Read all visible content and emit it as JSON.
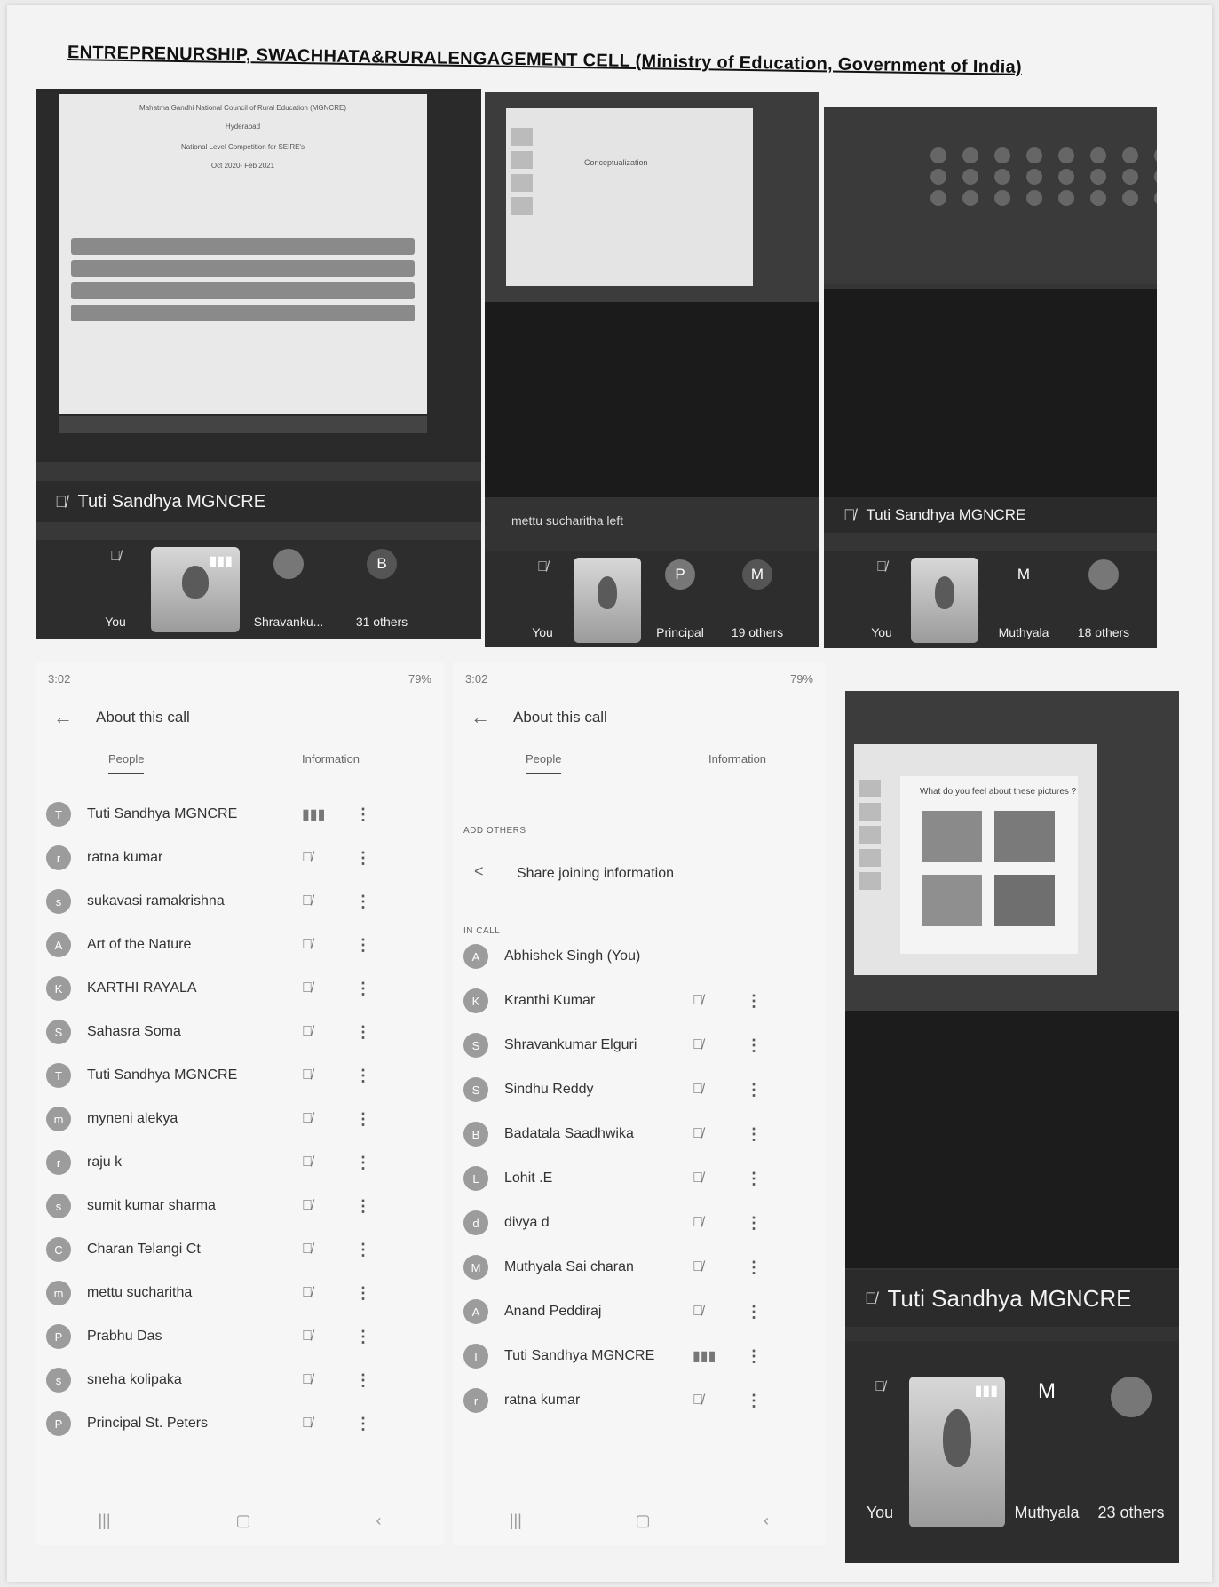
{
  "document": {
    "title": "ENTREPRENURSHIP, SWACHHATA&RURALENGAGEMENT CELL (Ministry of Education, Government of India)"
  },
  "shot1": {
    "doc_lines": [
      "Mahatma Gandhi National Council of Rural Education (MGNCRE)",
      "Hyderabad",
      "National Level Competition for SEIRE's",
      "Oct 2020- Feb 2021"
    ],
    "speaker": "Tuti Sandhya MGNCRE",
    "tiles": [
      {
        "label": "You"
      },
      {
        "label": "Shravanku..."
      },
      {
        "label": "31 others",
        "initial": "B"
      }
    ]
  },
  "shot2": {
    "slide_title": "Conceptualization",
    "notice": "mettu sucharitha left",
    "tiles": [
      {
        "label": "You"
      },
      {
        "label": "Principal",
        "initial": "P"
      },
      {
        "label": "19 others",
        "initial": "M"
      }
    ]
  },
  "shot3": {
    "speaker": "Tuti Sandhya MGNCRE",
    "tiles": [
      {
        "label": "You"
      },
      {
        "label": "Muthyala",
        "initial": "M"
      },
      {
        "label": "18 others"
      }
    ]
  },
  "shot4": {
    "slide_question": "What do you feel about these pictures ?",
    "speaker": "Tuti Sandhya MGNCRE",
    "tiles": [
      {
        "label": "You"
      },
      {
        "label": "Muthyala",
        "initial": "M"
      },
      {
        "label": "23 others"
      }
    ]
  },
  "phone1": {
    "status_time": "3:02",
    "status_right": "79%",
    "title": "About this call",
    "tabs": [
      "People",
      "Information"
    ],
    "participants": [
      {
        "name": "Tuti Sandhya MGNCRE",
        "initial": "T",
        "speaking": true
      },
      {
        "name": "ratna kumar",
        "initial": "r"
      },
      {
        "name": "sukavasi ramakrishna",
        "initial": "s"
      },
      {
        "name": "Art of the Nature",
        "initial": "A"
      },
      {
        "name": "KARTHI RAYALA",
        "initial": "K"
      },
      {
        "name": "Sahasra Soma",
        "initial": "S"
      },
      {
        "name": "Tuti Sandhya MGNCRE",
        "initial": "T"
      },
      {
        "name": "myneni alekya",
        "initial": "m"
      },
      {
        "name": "raju k",
        "initial": "r"
      },
      {
        "name": "sumit kumar sharma",
        "initial": "s"
      },
      {
        "name": "Charan Telangi Ct",
        "initial": "C"
      },
      {
        "name": "mettu sucharitha",
        "initial": "m"
      },
      {
        "name": "Prabhu Das",
        "initial": "P"
      },
      {
        "name": "sneha kolipaka",
        "initial": "s"
      },
      {
        "name": "Principal St. Peters",
        "initial": "P"
      }
    ]
  },
  "phone2": {
    "status_time": "3:02",
    "status_right": "79%",
    "title": "About this call",
    "tabs": [
      "People",
      "Information"
    ],
    "add_others_label": "ADD OTHERS",
    "share_label": "Share joining information",
    "in_call_label": "IN CALL",
    "participants": [
      {
        "name": "Abhishek Singh (You)",
        "initial": "A",
        "self": true
      },
      {
        "name": "Kranthi Kumar",
        "initial": "K"
      },
      {
        "name": "Shravankumar Elguri",
        "initial": "S"
      },
      {
        "name": "Sindhu Reddy",
        "initial": "S"
      },
      {
        "name": "Badatala Saadhwika",
        "initial": "B"
      },
      {
        "name": "Lohit .E",
        "initial": "L"
      },
      {
        "name": "divya d",
        "initial": "d"
      },
      {
        "name": "Muthyala Sai charan",
        "initial": "M"
      },
      {
        "name": "Anand Peddiraj",
        "initial": "A"
      },
      {
        "name": "Tuti Sandhya MGNCRE",
        "initial": "T",
        "speaking": true
      },
      {
        "name": "ratna kumar",
        "initial": "r"
      }
    ]
  },
  "icons": {
    "mic_off": "🎙̸",
    "more": "⋮",
    "back": "←",
    "share": "<",
    "speaking": "▮▮▮"
  }
}
